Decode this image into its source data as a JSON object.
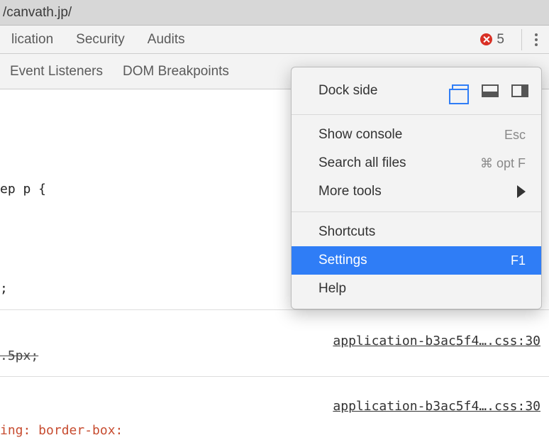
{
  "addressbar": {
    "url": "/canvath.jp/"
  },
  "toolbar": {
    "tabs": [
      "lication",
      "Security",
      "Audits"
    ],
    "error_count": "5"
  },
  "subtoolbar": {
    "tabs": [
      "Event Listeners",
      "DOM Breakpoints"
    ]
  },
  "code": {
    "line1": "ep p {",
    "line2": ";",
    "line3": ".5px;",
    "line4": "ing: border-box:"
  },
  "css_links": {
    "a": "application-b3ac5f4….css:30",
    "b": "application-b3ac5f4….css:30"
  },
  "menu": {
    "dock_label": "Dock side",
    "show_console": {
      "label": "Show console",
      "accel": "Esc"
    },
    "search_all": {
      "label": "Search all files",
      "accel": "⌘ opt F"
    },
    "more_tools": {
      "label": "More tools"
    },
    "shortcuts": {
      "label": "Shortcuts"
    },
    "settings": {
      "label": "Settings",
      "accel": "F1"
    },
    "help": {
      "label": "Help"
    }
  }
}
